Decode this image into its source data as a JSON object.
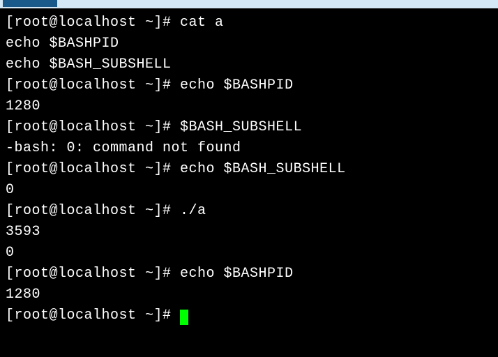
{
  "tab": {
    "label": ""
  },
  "terminal": {
    "lines": [
      "[root@localhost ~]# cat a",
      "echo $BASHPID",
      "echo $BASH_SUBSHELL",
      "[root@localhost ~]# echo $BASHPID",
      "1280",
      "[root@localhost ~]# $BASH_SUBSHELL",
      "-bash: 0: command not found",
      "[root@localhost ~]# echo $BASH_SUBSHELL",
      "0",
      "[root@localhost ~]# ./a",
      "3593",
      "0",
      "[root@localhost ~]# echo $BASHPID",
      "1280",
      "[root@localhost ~]# "
    ]
  }
}
